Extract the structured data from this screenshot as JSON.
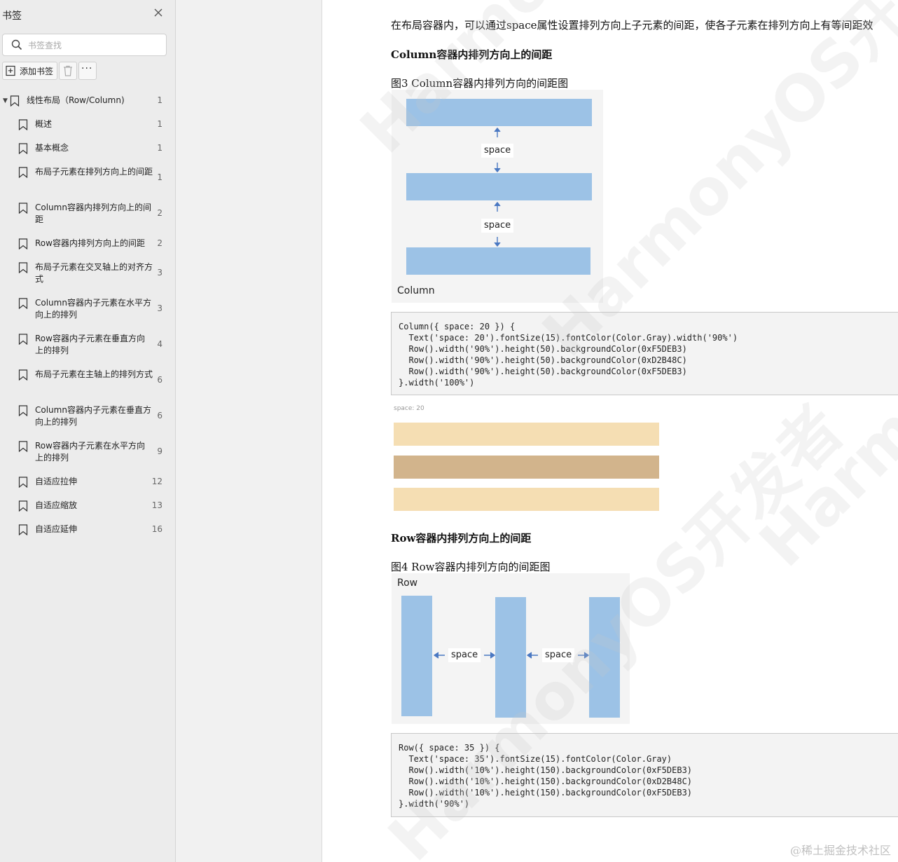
{
  "sidebar": {
    "title": "书签",
    "search_placeholder": "书签查找",
    "add_label": "添加书签",
    "more_label": "···",
    "items": [
      {
        "label": "线性布局（Row/Column)",
        "page": "1"
      },
      {
        "label": "概述",
        "page": "1"
      },
      {
        "label": "基本概念",
        "page": "1"
      },
      {
        "label": "布局子元素在排列方向上的间距",
        "page": "1"
      },
      {
        "label": "Column容器内排列方向上的间距",
        "page": "2"
      },
      {
        "label": "Row容器内排列方向上的间距",
        "page": "2"
      },
      {
        "label": "布局子元素在交叉轴上的对齐方式",
        "page": "3"
      },
      {
        "label": "Column容器内子元素在水平方向上的排列",
        "page": "3"
      },
      {
        "label": "Row容器内子元素在垂直方向上的排列",
        "page": "4"
      },
      {
        "label": "布局子元素在主轴上的排列方式",
        "page": "6"
      },
      {
        "label": "Column容器内子元素在垂直方向上的排列",
        "page": "6"
      },
      {
        "label": "Row容器内子元素在水平方向上的排列",
        "page": "9"
      },
      {
        "label": "自适应拉伸",
        "page": "12"
      },
      {
        "label": "自适应缩放",
        "page": "13"
      },
      {
        "label": "自适应延伸",
        "page": "16"
      }
    ]
  },
  "doc": {
    "intro": "在布局容器内，可以通过space属性设置排列方向上子元素的间距，使各子元素在排列方向上有等间距效",
    "h_column": "Column容器内排列方向上的间距",
    "fig3_caption": "图3 Column容器内排列方向的间距图",
    "fig3": {
      "space1": "space",
      "space2": "space",
      "label": "Column"
    },
    "code1": [
      "Column({ space: 20 }) {",
      "  Text('space: 20').fontSize(15).fontColor(Color.Gray).width('90%')",
      "  Row().width('90%').height(50).backgroundColor(0xF5DEB3)",
      "  Row().width('90%').height(50).backgroundColor(0xD2B48C)",
      "  Row().width('90%').height(50).backgroundColor(0xF5DEB3)",
      "}.width('100%')"
    ],
    "preview1_label": "space: 20",
    "preview1_colors": [
      "#F5DEB3",
      "#D2B48C",
      "#F5DEB3"
    ],
    "h_row": "Row容器内排列方向上的间距",
    "fig4_caption": "图4 Row容器内排列方向的间距图",
    "fig4": {
      "label": "Row",
      "space1": "space",
      "space2": "space"
    },
    "code2": [
      "Row({ space: 35 }) {",
      "  Text('space: 35').fontSize(15).fontColor(Color.Gray)",
      "  Row().width('10%').height(150).backgroundColor(0xF5DEB3)",
      "  Row().width('10%').height(150).backgroundColor(0xD2B48C)",
      "  Row().width('10%').height(150).backgroundColor(0xF5DEB3)",
      "}.width('90%')"
    ],
    "watermark": "HarmonyOS开发者",
    "footer": "@稀土掘金技术社区"
  },
  "colors": {
    "bar_blue": "#9cc2e6",
    "arrow_blue": "#4a78c2"
  }
}
